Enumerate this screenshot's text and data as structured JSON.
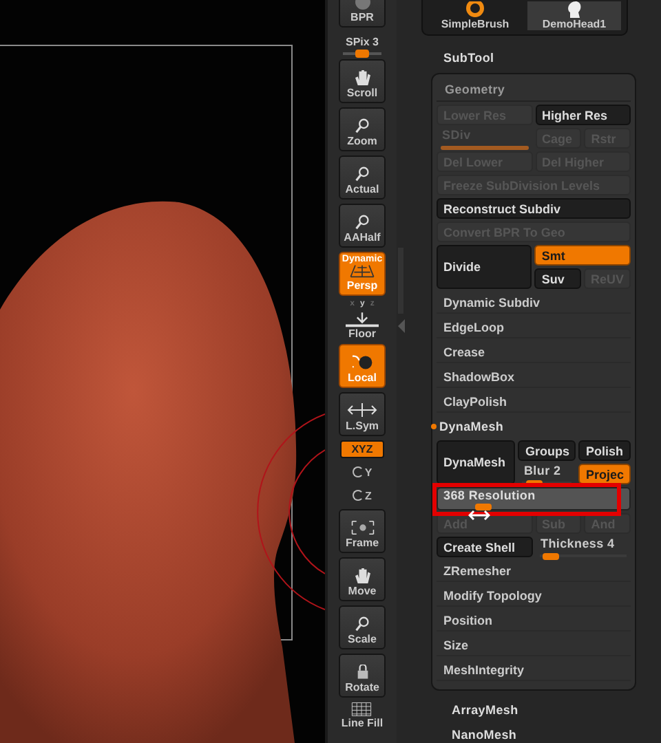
{
  "toolbar": [
    {
      "kind": "button",
      "label": "BPR",
      "on": false
    },
    {
      "kind": "slider",
      "label": "SPix 3",
      "level": 0.5
    },
    {
      "kind": "button",
      "label": "Scroll",
      "on": false
    },
    {
      "kind": "button",
      "label": "Zoom",
      "on": false
    },
    {
      "kind": "button",
      "label": "Actual",
      "on": false
    },
    {
      "kind": "button",
      "label": "AAHalf",
      "on": false
    },
    {
      "kind": "button",
      "label": "Persp",
      "caption": "Dynamic",
      "on": true
    },
    {
      "kind": "axes",
      "axes": [
        {
          "label": "x",
          "on": false
        },
        {
          "label": "y",
          "on": true
        },
        {
          "label": "z",
          "on": false
        }
      ]
    },
    {
      "kind": "flat",
      "label": "Floor"
    },
    {
      "kind": "button",
      "label": "Local",
      "on": true
    },
    {
      "kind": "button",
      "label": "L.Sym",
      "on": false
    },
    {
      "kind": "toggle",
      "label": "XYZ",
      "on": true
    },
    {
      "kind": "axis",
      "label": "Y"
    },
    {
      "kind": "axis",
      "label": "Z"
    },
    {
      "kind": "button",
      "label": "Frame",
      "on": false
    },
    {
      "kind": "button",
      "label": "Move",
      "on": false
    },
    {
      "kind": "button",
      "label": "Scale",
      "on": false
    },
    {
      "kind": "button",
      "label": "Rotate",
      "on": false
    },
    {
      "kind": "flat",
      "label": "Line Fill"
    }
  ],
  "brushes": [
    {
      "label": "SimpleBrush"
    },
    {
      "label": "DemoHead1"
    }
  ],
  "subtool": "SubTool",
  "geometry": {
    "title": "Geometry",
    "rows": [
      {
        "kind": "grid",
        "cells": [
          {
            "kind": "button",
            "label": "Lower Res",
            "disabled": true
          },
          {
            "kind": "button",
            "label": "Higher Res",
            "disabled": false
          }
        ]
      },
      {
        "kind": "grid",
        "cells": [
          {
            "kind": "fill-slider",
            "label": "SDiv",
            "level": 1,
            "disabled": true
          },
          {
            "kind": "button",
            "label": "Cage",
            "disabled": true
          },
          {
            "kind": "button",
            "label": "Rstr",
            "disabled": true
          }
        ]
      },
      {
        "kind": "grid",
        "cells": [
          {
            "kind": "button",
            "label": "Del Lower",
            "disabled": true
          },
          {
            "kind": "button",
            "label": "Del Higher",
            "disabled": true
          }
        ]
      },
      {
        "kind": "grid",
        "cells": [
          {
            "kind": "button",
            "label": "Freeze SubDivision Levels",
            "disabled": true
          }
        ]
      },
      {
        "kind": "grid",
        "cells": [
          {
            "kind": "button",
            "label": "Reconstruct Subdiv",
            "disabled": false
          }
        ]
      },
      {
        "kind": "grid",
        "cells": [
          {
            "kind": "button",
            "label": "Convert BPR To Geo",
            "disabled": true
          }
        ]
      },
      {
        "kind": "split",
        "cells": [
          {
            "kind": "button",
            "label": "Divide",
            "disabled": false
          },
          {
            "kind": "button",
            "label": "Smt",
            "on": true
          },
          {
            "kind": "button",
            "label": "Suv",
            "disabled": false
          },
          {
            "kind": "button",
            "label": "ReUV",
            "disabled": true
          }
        ]
      },
      {
        "kind": "item",
        "label": "Dynamic Subdiv"
      },
      {
        "kind": "item",
        "label": "EdgeLoop"
      },
      {
        "kind": "item",
        "label": "Crease"
      },
      {
        "kind": "item",
        "label": "ShadowBox"
      },
      {
        "kind": "item",
        "label": "ClayPolish"
      },
      {
        "kind": "section",
        "label": "DynaMesh",
        "marked": true
      },
      {
        "kind": "split",
        "cells": [
          {
            "kind": "button",
            "label": "DynaMesh",
            "disabled": false
          },
          {
            "kind": "button",
            "label": "Groups",
            "disabled": false
          },
          {
            "kind": "button",
            "label": "Polish",
            "disabled": false
          },
          {
            "kind": "slider",
            "label": "Blur 2",
            "level": 0.1
          },
          {
            "kind": "button",
            "label": "Projec",
            "on": true
          }
        ]
      },
      {
        "kind": "grid",
        "cells": [
          {
            "kind": "box-slider",
            "label": "368 Resolution",
            "level": 0.2,
            "highlighted": true
          }
        ]
      },
      {
        "kind": "grid",
        "cells": [
          {
            "kind": "button",
            "label": "Add",
            "disabled": true
          },
          {
            "kind": "button",
            "label": "Sub",
            "disabled": true
          },
          {
            "kind": "button",
            "label": "And",
            "disabled": true
          }
        ]
      },
      {
        "kind": "grid",
        "cells": [
          {
            "kind": "button",
            "label": "Create Shell",
            "disabled": false
          },
          {
            "kind": "slider",
            "label": "Thickness 4",
            "level": 0.05
          }
        ]
      },
      {
        "kind": "item",
        "label": "ZRemesher"
      },
      {
        "kind": "item",
        "label": "Modify Topology"
      },
      {
        "kind": "item",
        "label": "Position"
      },
      {
        "kind": "item",
        "label": "Size"
      },
      {
        "kind": "item",
        "label": "MeshIntegrity"
      }
    ]
  },
  "after": [
    {
      "label": "ArrayMesh"
    },
    {
      "label": "NanoMesh"
    }
  ]
}
